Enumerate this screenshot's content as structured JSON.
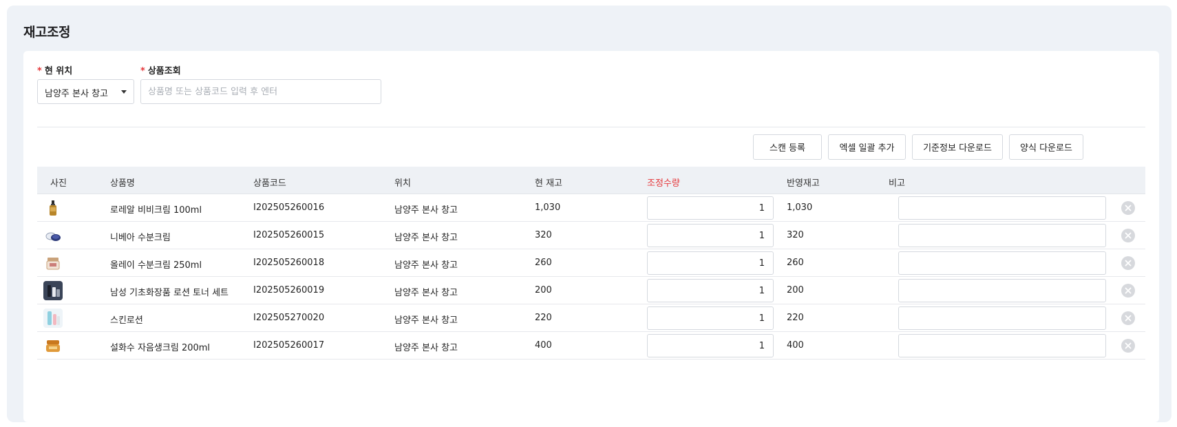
{
  "page_title": "재고조정",
  "location": {
    "label": "현 위치",
    "required_mark": "*",
    "selected": "남양주 본사 창고"
  },
  "product_search": {
    "label": "상품조회",
    "required_mark": "*",
    "placeholder": "상품명 또는 상품코드 입력 후 엔터",
    "value": ""
  },
  "actions": {
    "scan": "스캔 등록",
    "excel_bulk": "엑셀 일괄 추가",
    "master_download": "기준정보 다운로드",
    "template_download": "양식 다운로드"
  },
  "table": {
    "headers": {
      "photo": "사진",
      "name": "상품명",
      "code": "상품코드",
      "location": "위치",
      "current_stock": "현 재고",
      "adjust_qty": "조정수량",
      "reflected_stock": "반영재고",
      "note": "비고"
    },
    "rows": [
      {
        "name": "로레알 비비크림 100ml",
        "code": "I202505260016",
        "location": "남양주 본사 창고",
        "current_stock": "1,030",
        "adjust_qty": "1",
        "reflected_stock": "1,030",
        "note": "",
        "icon": "serum-bottle-icon"
      },
      {
        "name": "니베아 수분크림",
        "code": "I202505260015",
        "location": "남양주 본사 창고",
        "current_stock": "320",
        "adjust_qty": "1",
        "reflected_stock": "320",
        "note": "",
        "icon": "cream-tin-icon"
      },
      {
        "name": "올레이 수분크림 250ml",
        "code": "I202505260018",
        "location": "남양주 본사 창고",
        "current_stock": "260",
        "adjust_qty": "1",
        "reflected_stock": "260",
        "note": "",
        "icon": "cream-jar-icon"
      },
      {
        "name": "남성 기초화장품 로션 토너 세트",
        "code": "I202505260019",
        "location": "남양주 본사 창고",
        "current_stock": "200",
        "adjust_qty": "1",
        "reflected_stock": "200",
        "note": "",
        "icon": "skincare-set-icon"
      },
      {
        "name": "스킨로션",
        "code": "I202505270020",
        "location": "남양주 본사 창고",
        "current_stock": "220",
        "adjust_qty": "1",
        "reflected_stock": "220",
        "note": "",
        "icon": "lotion-bottles-icon"
      },
      {
        "name": "설화수 자음생크림 200ml",
        "code": "I202505260017",
        "location": "남양주 본사 창고",
        "current_stock": "400",
        "adjust_qty": "1",
        "reflected_stock": "400",
        "note": "",
        "icon": "gold-cream-jar-icon"
      }
    ]
  },
  "colors": {
    "required": "#e5383b",
    "adjust_header": "#e5383b",
    "background": "#eef2f7",
    "table_header": "#eef1f5"
  }
}
